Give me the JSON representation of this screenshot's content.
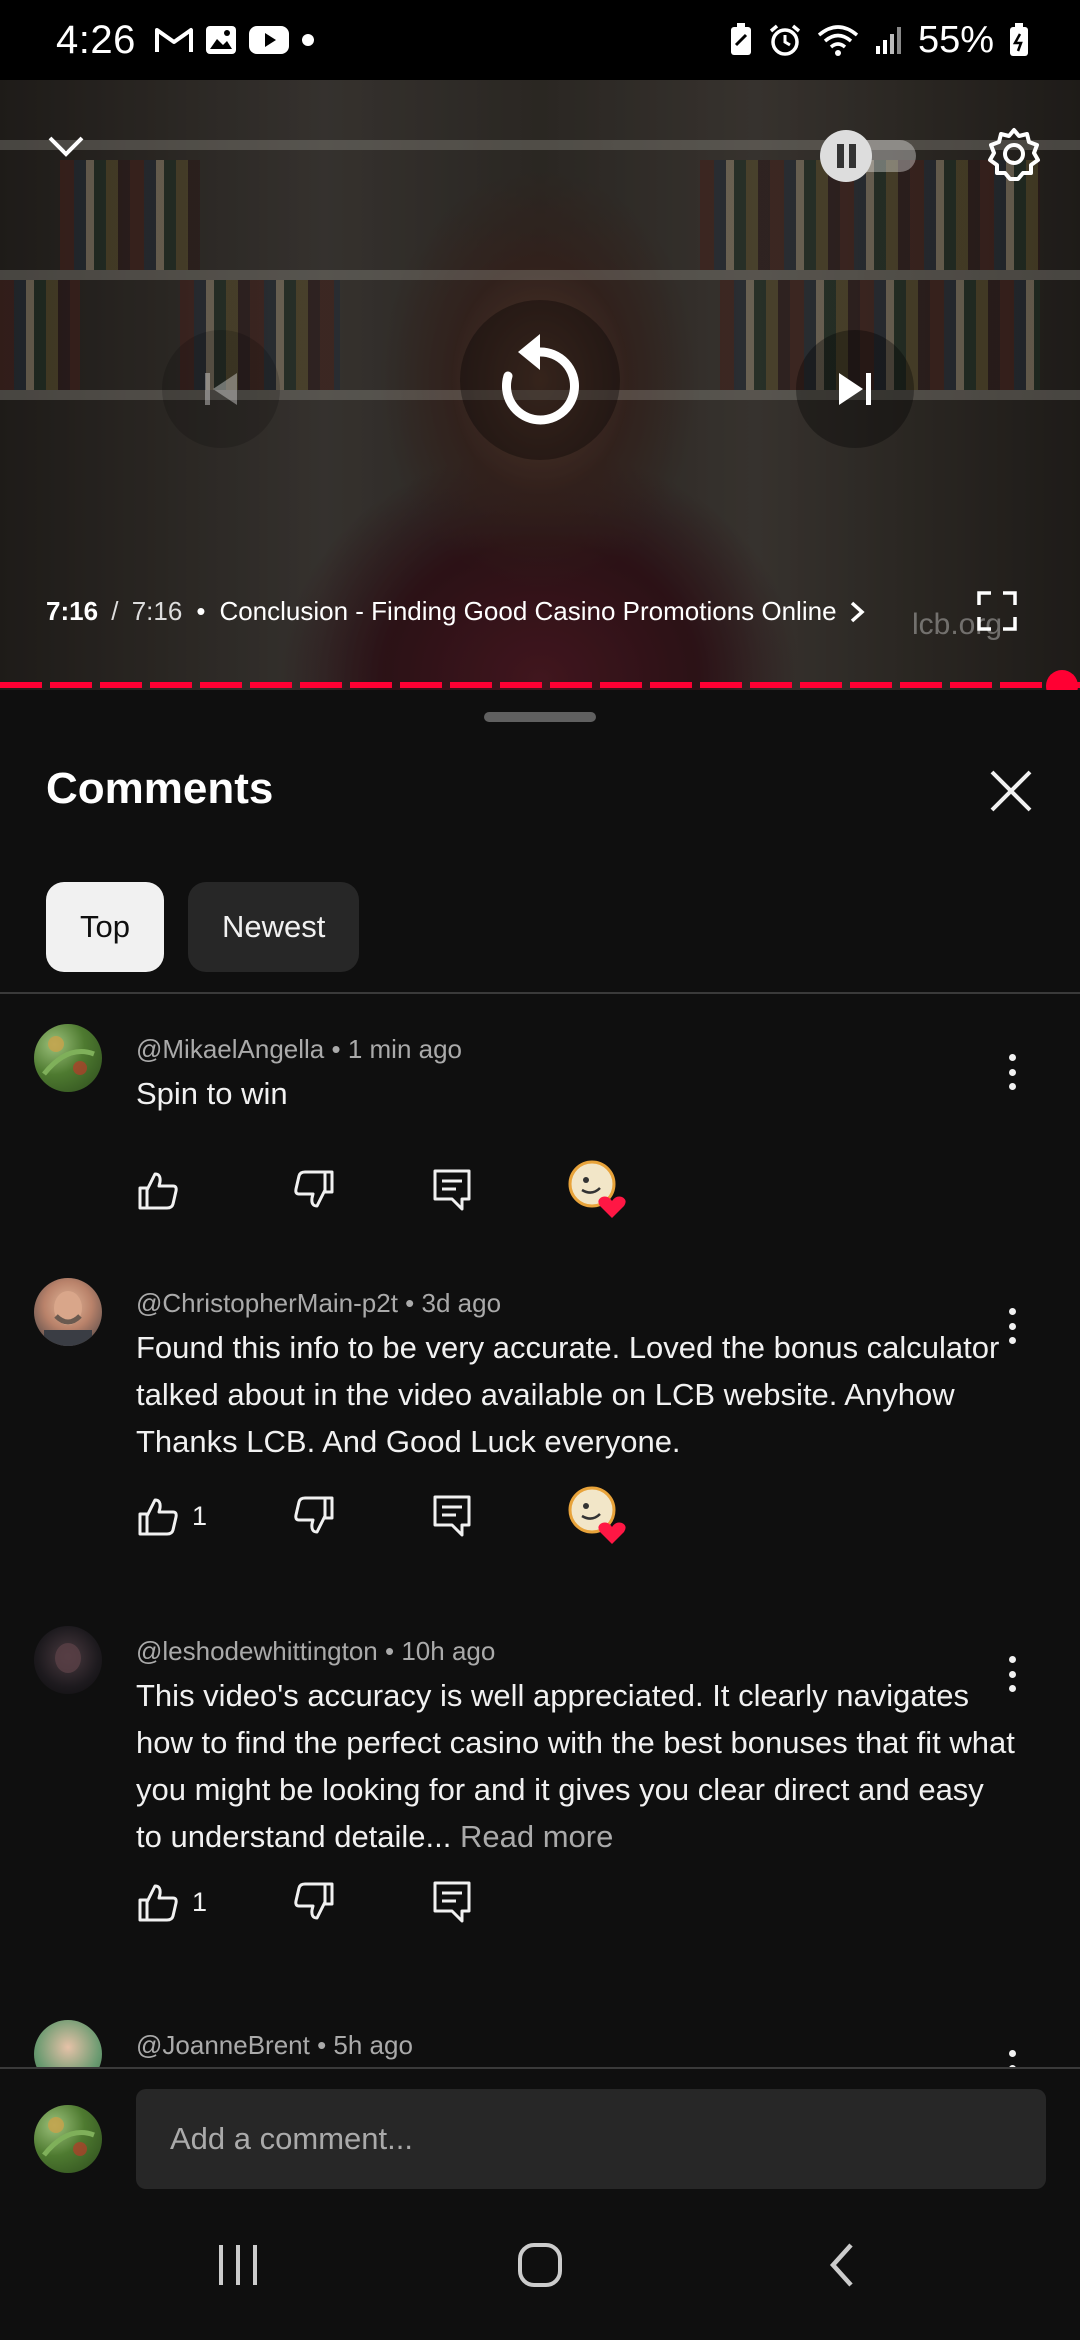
{
  "status_bar": {
    "time": "4:26",
    "battery": "55%",
    "left_icons": [
      "gmail-icon",
      "gallery-icon",
      "youtube-icon",
      "dot-icon"
    ],
    "right_icons": [
      "battery-saver-icon",
      "alarm-icon",
      "wifi-icon",
      "signal-icon",
      "battery-icon"
    ]
  },
  "player": {
    "current_time": "7:16",
    "separator": " / ",
    "total_time": "7:16",
    "chapter_prefix": "•",
    "chapter": "Conclusion - Finding Good Casino Promotions Online",
    "watermark": "lcb.org",
    "progress": 1.0,
    "autoplay": "off",
    "accent": "#ff0033"
  },
  "comments_panel": {
    "title": "Comments",
    "chips": [
      {
        "label": "Top",
        "selected": true
      },
      {
        "label": "Newest",
        "selected": false
      }
    ],
    "comments": [
      {
        "author": "@MikaelAngella",
        "time": "1 min ago",
        "text": "Spin to win",
        "likes": "",
        "hearted": true,
        "read_more": ""
      },
      {
        "author": "@ChristopherMain-p2t",
        "time": "3d ago",
        "text": "Found this info to be very accurate. Loved the bonus calculator talked about in the video available on LCB website. Anyhow Thanks LCB. And Good Luck everyone.",
        "likes": "1",
        "hearted": true,
        "read_more": ""
      },
      {
        "author": "@leshodewhittington",
        "time": "10h ago",
        "text": "This video's accuracy is well appreciated.  It clearly navigates how to find the perfect casino with the best bonuses that fit what you might be looking for and it gives you clear direct and easy to understand detaile...",
        "likes": "1",
        "hearted": false,
        "read_more": "Read more"
      },
      {
        "author": "@JoanneBrent",
        "time": "5h ago",
        "text": "",
        "likes": "",
        "hearted": false,
        "read_more": ""
      }
    ],
    "meta_separator": " • ",
    "add_comment_placeholder": "Add a comment..."
  },
  "nav_bar": {
    "buttons": [
      "recents-icon",
      "home-icon",
      "back-icon"
    ]
  }
}
